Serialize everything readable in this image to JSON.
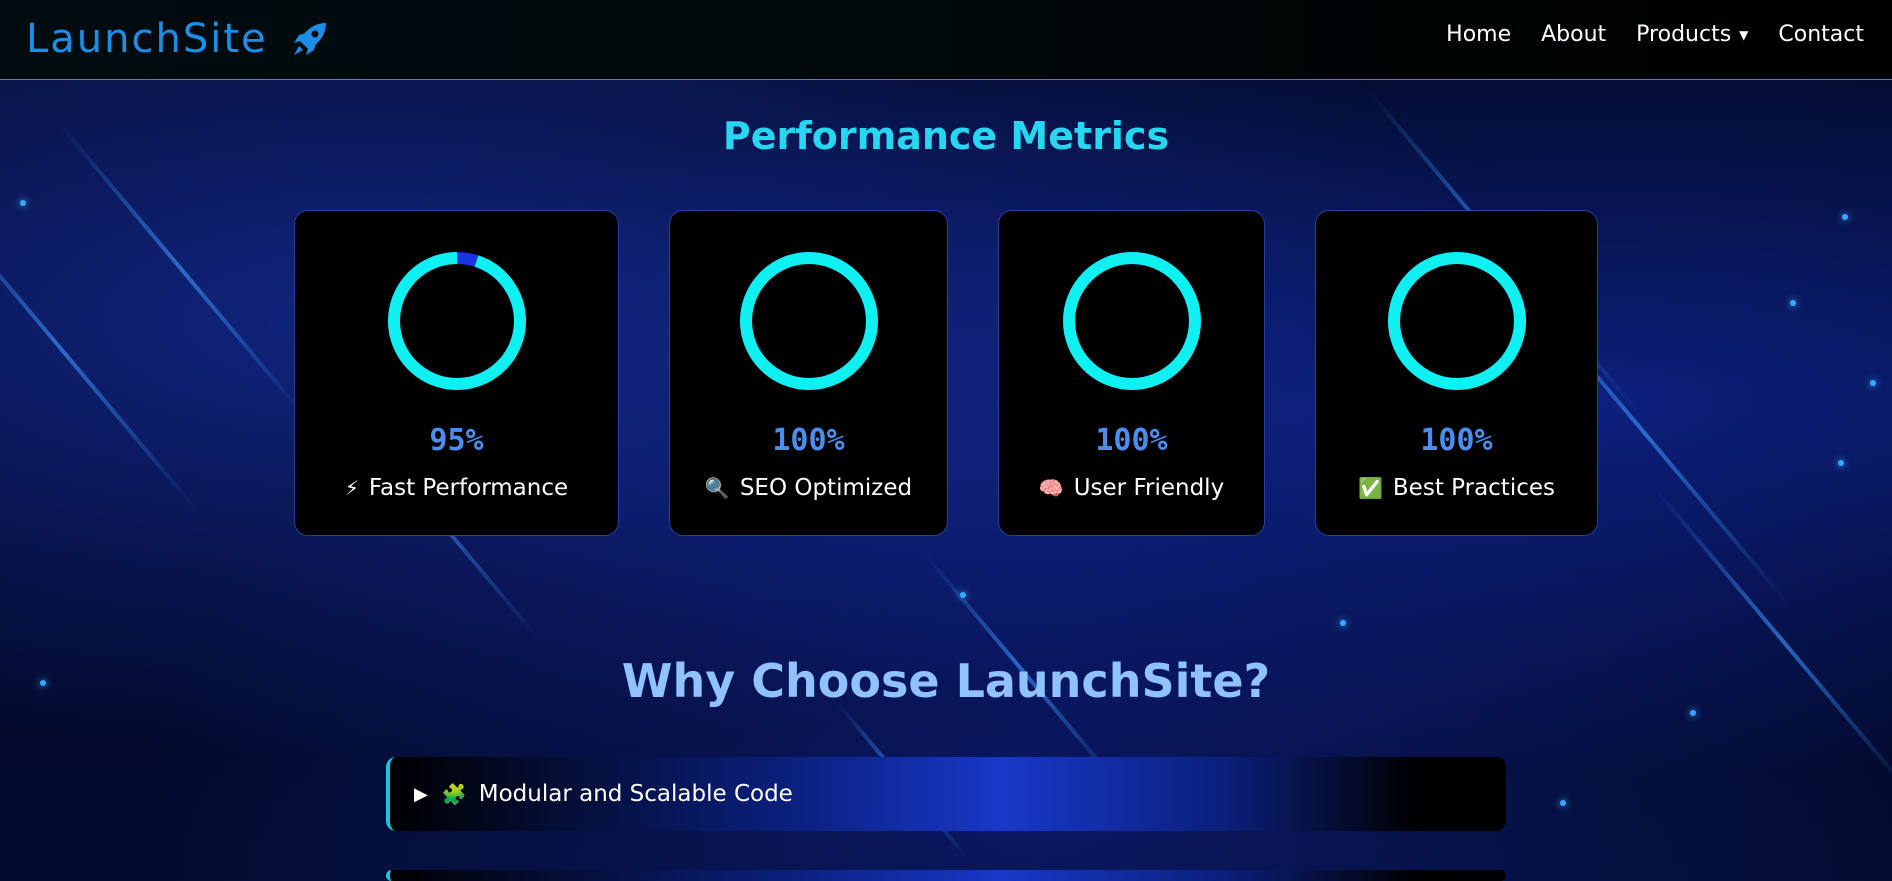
{
  "brand": {
    "name": "LaunchSite",
    "icon": "rocket-icon",
    "color": "#1b8fe8"
  },
  "nav": {
    "items": [
      {
        "label": "Home"
      },
      {
        "label": "About"
      },
      {
        "label": "Products",
        "has_dropdown": true,
        "caret": "▼"
      },
      {
        "label": "Contact"
      }
    ]
  },
  "metrics": {
    "title": "Performance Metrics",
    "cards": [
      {
        "value": "95%",
        "percent": 95,
        "emoji": "⚡",
        "label": "Fast Performance"
      },
      {
        "value": "100%",
        "percent": 100,
        "emoji": "🔍",
        "label": "SEO Optimized"
      },
      {
        "value": "100%",
        "percent": 100,
        "emoji": "🧠",
        "label": "User Friendly"
      },
      {
        "value": "100%",
        "percent": 100,
        "emoji": "✅",
        "label": "Best Practices"
      }
    ],
    "ring_color": "#0ff0f0",
    "ring_track_color": "#1a35e0"
  },
  "why": {
    "title": "Why Choose LaunchSite?",
    "items": [
      {
        "marker": "▶",
        "emoji": "🧩",
        "label": "Modular and Scalable Code"
      },
      {
        "marker": "",
        "emoji": "",
        "label": ""
      }
    ]
  }
}
